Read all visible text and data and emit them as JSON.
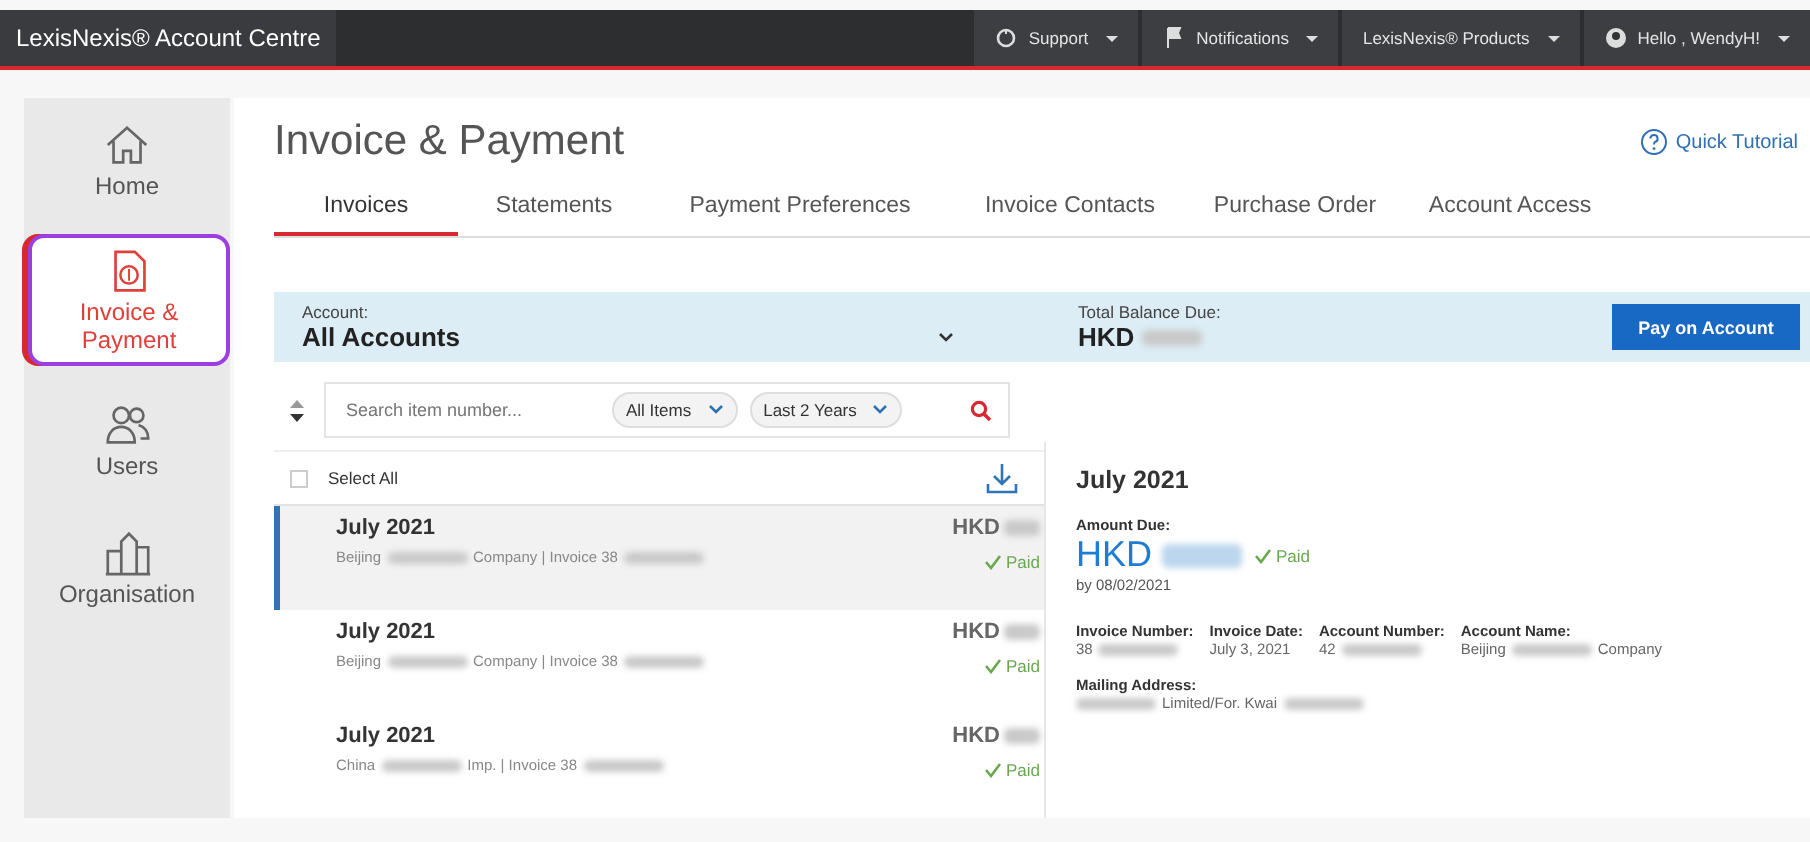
{
  "topbar": {
    "brand": "LexisNexis® Account Centre",
    "menus": [
      {
        "label": "Support"
      },
      {
        "label": "Notifications"
      },
      {
        "label": "LexisNexis® Products"
      },
      {
        "label": "Hello , WendyH!"
      }
    ]
  },
  "sidebar": {
    "items": [
      {
        "label": "Home",
        "selected": false
      },
      {
        "label": "Invoice & Payment",
        "selected": true
      },
      {
        "label": "Users",
        "selected": false
      },
      {
        "label": "Organisation",
        "selected": false
      }
    ]
  },
  "page": {
    "title": "Invoice & Payment",
    "tutorial": "Quick Tutorial"
  },
  "tabs": [
    {
      "label": "Invoices",
      "selected": true
    },
    {
      "label": "Statements",
      "selected": false
    },
    {
      "label": "Payment Preferences",
      "selected": false
    },
    {
      "label": "Invoice Contacts",
      "selected": false
    },
    {
      "label": "Purchase Order",
      "selected": false
    },
    {
      "label": "Account Access",
      "selected": false
    }
  ],
  "account_bar": {
    "account_label": "Account:",
    "account_value": "All Accounts",
    "balance_label": "Total Balance Due:",
    "balance_value": [
      {
        "kind": "text",
        "text": "HKD"
      },
      {
        "kind": "redacted"
      }
    ],
    "pay_button": "Pay on Account"
  },
  "filters": {
    "search_placeholder": "Search item number...",
    "items_filter": "All Items",
    "period_filter": "Last 2 Years"
  },
  "select_all": {
    "label": "Select All",
    "checked": false
  },
  "invoices": [
    {
      "selected": true,
      "title": "July 2021",
      "amount": [
        {
          "kind": "text",
          "text": "HKD"
        },
        {
          "kind": "redacted"
        }
      ],
      "status": "Paid",
      "subtitle": [
        {
          "kind": "text",
          "text": "Beijing"
        },
        {
          "kind": "redacted"
        },
        {
          "kind": "text",
          "text": "Company | Invoice 38"
        },
        {
          "kind": "redacted"
        }
      ]
    },
    {
      "selected": false,
      "title": "July 2021",
      "amount": [
        {
          "kind": "text",
          "text": "HKD"
        },
        {
          "kind": "redacted"
        }
      ],
      "status": "Paid",
      "subtitle": [
        {
          "kind": "text",
          "text": "Beijing"
        },
        {
          "kind": "redacted"
        },
        {
          "kind": "text",
          "text": "Company | Invoice 38"
        },
        {
          "kind": "redacted"
        }
      ]
    },
    {
      "selected": false,
      "title": "July 2021",
      "amount": [
        {
          "kind": "text",
          "text": "HKD"
        },
        {
          "kind": "redacted"
        }
      ],
      "status": "Paid",
      "subtitle": [
        {
          "kind": "text",
          "text": "China"
        },
        {
          "kind": "redacted"
        },
        {
          "kind": "text",
          "text": "Imp. | Invoice 38"
        },
        {
          "kind": "redacted"
        }
      ]
    }
  ],
  "detail": {
    "title": "July 2021",
    "amount_label": "Amount Due:",
    "amount": [
      {
        "kind": "text",
        "text": "HKD"
      },
      {
        "kind": "redacted"
      }
    ],
    "status": "Paid",
    "due": "by 08/02/2021",
    "fields": [
      {
        "label": "Invoice Number:",
        "value": [
          {
            "kind": "text",
            "text": "38"
          },
          {
            "kind": "redacted"
          }
        ]
      },
      {
        "label": "Invoice Date:",
        "value": [
          {
            "kind": "text",
            "text": "July 3, 2021"
          }
        ]
      },
      {
        "label": "Account Number:",
        "value": [
          {
            "kind": "text",
            "text": "42"
          },
          {
            "kind": "redacted"
          }
        ]
      },
      {
        "label": "Account Name:",
        "value": [
          {
            "kind": "text",
            "text": "Beijing"
          },
          {
            "kind": "redacted"
          },
          {
            "kind": "text",
            "text": "Company"
          }
        ]
      }
    ],
    "address_label": "Mailing Address:",
    "address": [
      {
        "kind": "redacted"
      },
      {
        "kind": "text",
        "text": "Limited/For. Kwai"
      },
      {
        "kind": "redacted"
      }
    ]
  }
}
